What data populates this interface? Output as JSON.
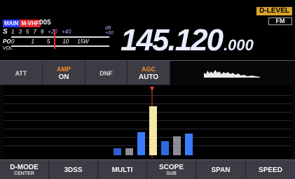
{
  "header": {
    "band_tag_main": "MAIN",
    "band_tag_band": "M-VHF",
    "memory_channel": "005",
    "d_level": "D-LEVEL",
    "mode": "FM"
  },
  "meter": {
    "s_label": "S",
    "s_scale": [
      "1",
      "3",
      "5",
      "7",
      "9",
      "+20",
      "+40",
      "+60"
    ],
    "db_label": "dB",
    "po_label": "PO",
    "po_scale": [
      "0",
      "1",
      "5",
      "10",
      "15W"
    ],
    "vol_label": "VOL"
  },
  "frequency": {
    "main": "145.120",
    "fraction": ".000"
  },
  "function_bar": {
    "att": {
      "caption": "ATT",
      "value": ""
    },
    "amp": {
      "caption": "AMP",
      "value": "ON"
    },
    "dnf": {
      "caption": "DNF",
      "value": ""
    },
    "agc": {
      "caption": "AGC",
      "value": "AUTO"
    }
  },
  "bottom_keys": [
    {
      "main": "D-MODE",
      "sub": "CENTER"
    },
    {
      "main": "3DSS",
      "sub": ""
    },
    {
      "main": "MULTI",
      "sub": ""
    },
    {
      "main": "SCOPE",
      "sub": "SUB"
    },
    {
      "main": "SPAN",
      "sub": ""
    },
    {
      "main": "SPEED",
      "sub": ""
    }
  ],
  "scope_signals": [
    {
      "level": 0.1,
      "color": "#2f5fd0"
    },
    {
      "level": 0.1,
      "color": "#8a8d96"
    },
    {
      "level": 0.33,
      "color": "#3a7bff"
    },
    {
      "level": 0.7,
      "color": "#f6e7a8"
    },
    {
      "level": 0.2,
      "color": "#2f6be0"
    },
    {
      "level": 0.27,
      "color": "#8a8d96"
    },
    {
      "level": 0.31,
      "color": "#3a7bff"
    }
  ],
  "colors": {
    "accent_orange": "#ff8c2a",
    "d_level_bg": "#d7a32a",
    "band_tag_blue": "#2a3cff",
    "band_tag_red": "#e0262e",
    "needle_red": "#ff2a2a"
  }
}
